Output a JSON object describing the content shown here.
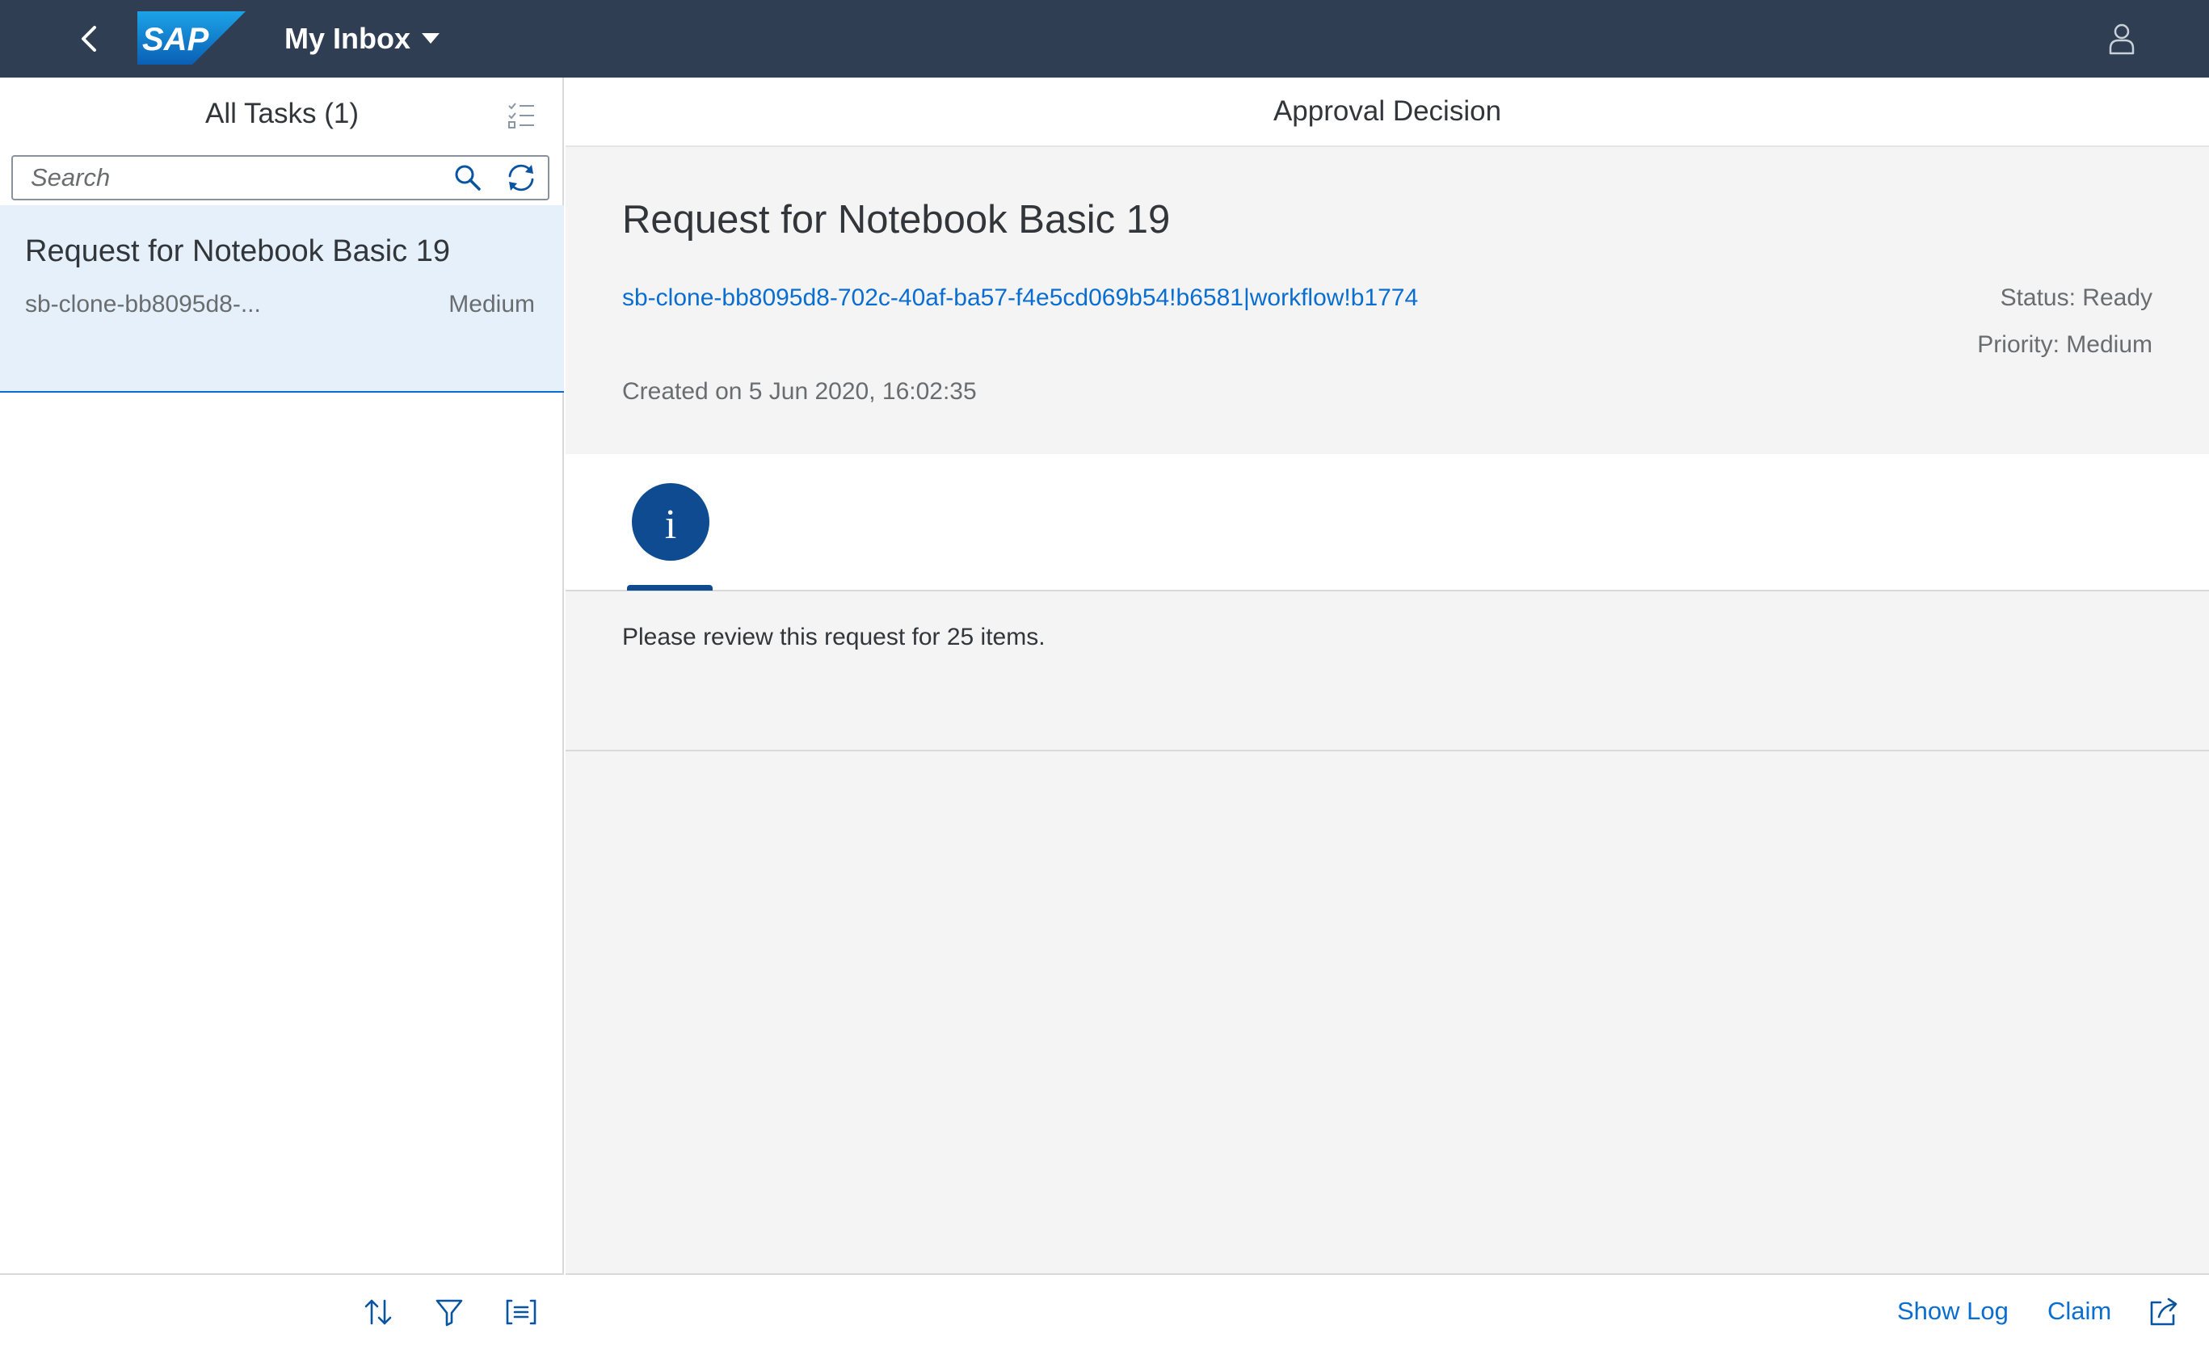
{
  "shell": {
    "logo_text": "SAP",
    "app_title": "My Inbox",
    "back_icon": "chevron-left-icon",
    "dropdown_icon": "caret-down-icon",
    "user_icon": "person-icon"
  },
  "master": {
    "title": "All Tasks (1)",
    "search": {
      "placeholder": "Search",
      "value": ""
    },
    "tasks": [
      {
        "title": "Request for Notebook Basic 19",
        "id": "sb-clone-bb8095d8-...",
        "priority": "Medium"
      }
    ],
    "footer_icons": [
      "sort-icon",
      "filter-icon",
      "group-icon"
    ]
  },
  "detail": {
    "header_title": "Approval Decision",
    "object_title": "Request for Notebook Basic 19",
    "link": "sb-clone-bb8095d8-702c-40af-ba57-f4e5cd069b54!b6581|workflow!b1774",
    "status": "Status: Ready",
    "priority": "Priority: Medium",
    "created": "Created on 5 Jun 2020, 16:02:35",
    "tab_icon": "information-icon",
    "tab_glyph": "i",
    "description": "Please review this request for 25 items.",
    "footer": {
      "show_log": "Show Log",
      "claim": "Claim",
      "share_icon": "share-icon"
    }
  },
  "colors": {
    "shell_bg": "#2f3e52",
    "accent": "#0a6ed1",
    "tab_accent": "#0f4b91",
    "selected_bg": "#e5f0fa"
  }
}
